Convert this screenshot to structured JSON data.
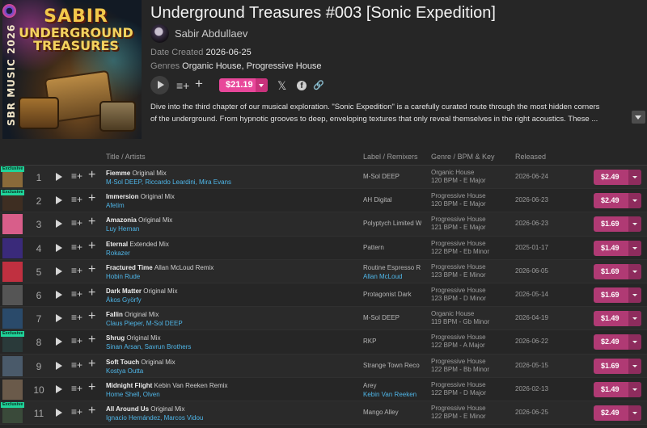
{
  "release": {
    "title": "Underground Treasures #003 [Sonic Expedition]",
    "artist": "Sabir Abdullaev",
    "date_label": "Date Created",
    "date_value": "2026-06-25",
    "genres_label": "Genres",
    "genres_value": "Organic House, Progressive House",
    "price": "$21.19",
    "description": "Dive into the third chapter of our musical exploration. \"Sonic Expedition\" is a carefully curated route through the most hidden corners of the underground. From hypnotic grooves to deep, enveloping textures that only reveal themselves in the right acoustics. These ...",
    "cover_text": {
      "line1": "SABIR",
      "line2": "UNDERGROUND",
      "line3": "TREASURES",
      "side": "SBR MUSIC 2026"
    }
  },
  "icons": {
    "queue": "≡+",
    "add": "+",
    "x": "𝕏",
    "facebook": "f",
    "link": "🔗"
  },
  "table": {
    "headers": {
      "title": "Title / Artists",
      "label": "Label / Remixers",
      "genre": "Genre / BPM & Key",
      "released": "Released"
    },
    "exclusive_badge": "Exclusive",
    "rows": [
      {
        "num": "1",
        "name": "Fiemme",
        "mix": "Original Mix",
        "artists": "M-Sol DEEP, Riccardo Leardini, Mira Evans",
        "label": "M-Sol DEEP",
        "remixer": "",
        "genre": "Organic House",
        "bpmkey": "120 BPM - E Major",
        "date": "2026-06-24",
        "price": "$2.49",
        "exclusive": true,
        "thumb": "#8a6a3a"
      },
      {
        "num": "2",
        "name": "Immersion",
        "mix": "Original Mix",
        "artists": "Afetim",
        "label": "AH Digital",
        "remixer": "",
        "genre": "Progressive House",
        "bpmkey": "120 BPM - E Major",
        "date": "2026-06-23",
        "price": "$2.49",
        "exclusive": true,
        "thumb": "#3e2e22"
      },
      {
        "num": "3",
        "name": "Amazonia",
        "mix": "Original Mix",
        "artists": "Luy Hernan",
        "label": "Polyptych Limited W",
        "remixer": "",
        "genre": "Progressive House",
        "bpmkey": "121 BPM - E Major",
        "date": "2026-06-23",
        "price": "$1.69",
        "exclusive": false,
        "thumb": "#d85e8a"
      },
      {
        "num": "4",
        "name": "Eternal",
        "mix": "Extended Mix",
        "artists": "Rokazer",
        "label": "Pattern",
        "remixer": "",
        "genre": "Progressive House",
        "bpmkey": "122 BPM - Eb Minor",
        "date": "2025-01-17",
        "price": "$1.49",
        "exclusive": false,
        "thumb": "#3a2a7a"
      },
      {
        "num": "5",
        "name": "Fractured Time",
        "mix": "Allan McLoud Remix",
        "artists": "Hobin Rude",
        "label": "Routine Espresso R",
        "remixer": "Allan McLoud",
        "genre": "Progressive House",
        "bpmkey": "123 BPM - E Minor",
        "date": "2026-06-05",
        "price": "$1.69",
        "exclusive": false,
        "thumb": "#c03040"
      },
      {
        "num": "6",
        "name": "Dark Matter",
        "mix": "Original Mix",
        "artists": "Ákos Györfy",
        "label": "Protagonist Dark",
        "remixer": "",
        "genre": "Progressive House",
        "bpmkey": "123 BPM - D Minor",
        "date": "2026-05-14",
        "price": "$1.69",
        "exclusive": false,
        "thumb": "#555555"
      },
      {
        "num": "7",
        "name": "Fallin",
        "mix": "Original Mix",
        "artists": "Claus Pieper, M-Sol DEEP",
        "label": "M-Sol DEEP",
        "remixer": "",
        "genre": "Organic House",
        "bpmkey": "119 BPM - Gb Minor",
        "date": "2026-04-19",
        "price": "$1.49",
        "exclusive": false,
        "thumb": "#2a4a6a"
      },
      {
        "num": "8",
        "name": "Shrug",
        "mix": "Original Mix",
        "artists": "Sinan Arsan, Savrun Brothers",
        "label": "RKP",
        "remixer": "",
        "genre": "Progressive House",
        "bpmkey": "122 BPM - A Major",
        "date": "2026-06-22",
        "price": "$2.49",
        "exclusive": true,
        "thumb": "#2a3a3a"
      },
      {
        "num": "9",
        "name": "Soft Touch",
        "mix": "Original Mix",
        "artists": "Kostya Outta",
        "label": "Strange Town Reco",
        "remixer": "",
        "genre": "Progressive House",
        "bpmkey": "122 BPM - Bb Minor",
        "date": "2026-05-15",
        "price": "$1.69",
        "exclusive": false,
        "thumb": "#4a5a6a"
      },
      {
        "num": "10",
        "name": "Midnight Flight",
        "mix": "Kebin Van Reeken Remix",
        "artists": "Home Shell, Olven",
        "label": "Arey",
        "remixer": "Kebin Van Reeken",
        "genre": "Progressive House",
        "bpmkey": "122 BPM - D Major",
        "date": "2026-02-13",
        "price": "$1.49",
        "exclusive": false,
        "thumb": "#6a5a4a"
      },
      {
        "num": "11",
        "name": "All Around Us",
        "mix": "Original Mix",
        "artists": "Ignacio Hernández, Marcos Vidou",
        "label": "Mango Alley",
        "remixer": "",
        "genre": "Progressive House",
        "bpmkey": "122 BPM - E Minor",
        "date": "2026-06-25",
        "price": "$2.49",
        "exclusive": true,
        "thumb": "#3a4a3a"
      }
    ]
  },
  "colors": {
    "accent": "#e8479a",
    "row_price": "#b03a74",
    "link": "#4fb6e8",
    "exclusive": "#1fd49a",
    "background": "#262626"
  }
}
